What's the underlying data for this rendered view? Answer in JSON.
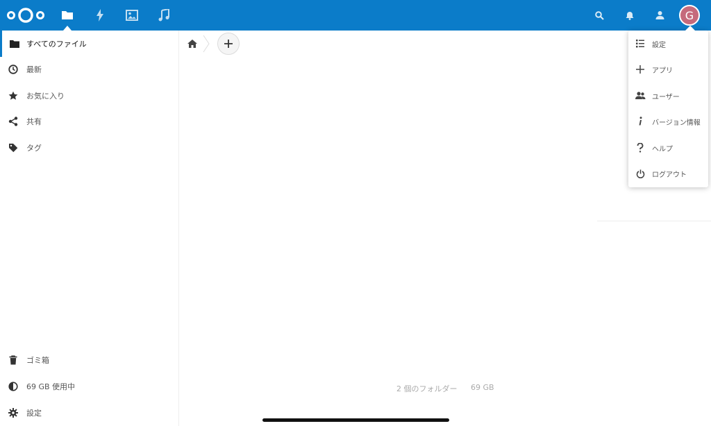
{
  "header": {
    "logo": "nextcloud-logo",
    "apps": [
      {
        "name": "files",
        "icon": "folder-icon",
        "active": true
      },
      {
        "name": "activity",
        "icon": "lightning-icon"
      },
      {
        "name": "gallery",
        "icon": "image-icon"
      },
      {
        "name": "music",
        "icon": "music-note-icon"
      }
    ],
    "right_icons": [
      "search-icon",
      "bell-icon",
      "contacts-icon"
    ],
    "avatar_initial": "G",
    "colors": {
      "bar": "#0b7cc9",
      "avatar": "#c56a7c"
    }
  },
  "sidebar": {
    "items": [
      {
        "label": "すべてのファイル",
        "icon": "folder-icon",
        "active": true
      },
      {
        "label": "最新",
        "icon": "clock-icon"
      },
      {
        "label": "お気に入り",
        "icon": "star-icon"
      },
      {
        "label": "共有",
        "icon": "share-icon"
      },
      {
        "label": "タグ",
        "icon": "tag-icon"
      }
    ],
    "footer": [
      {
        "label": "ゴミ箱",
        "icon": "trash-icon"
      },
      {
        "label": "69 GB 使用中",
        "icon": "quota-pie-icon"
      },
      {
        "label": "設定",
        "icon": "gear-icon"
      }
    ]
  },
  "main": {
    "breadcrumb": {
      "home_icon": "home-icon"
    },
    "new_button_icon": "plus-icon",
    "summary": {
      "folders": "2 個のフォルダー",
      "size": "69 GB"
    }
  },
  "settings_menu": {
    "items": [
      {
        "label": "設定",
        "icon": "settings-list-icon"
      },
      {
        "label": "アプリ",
        "icon": "plus-icon"
      },
      {
        "label": "ユーザー",
        "icon": "users-icon"
      },
      {
        "label": "バージョン情報",
        "icon": "info-icon"
      },
      {
        "label": "ヘルプ",
        "icon": "help-icon"
      },
      {
        "label": "ログアウト",
        "icon": "power-icon"
      }
    ]
  }
}
